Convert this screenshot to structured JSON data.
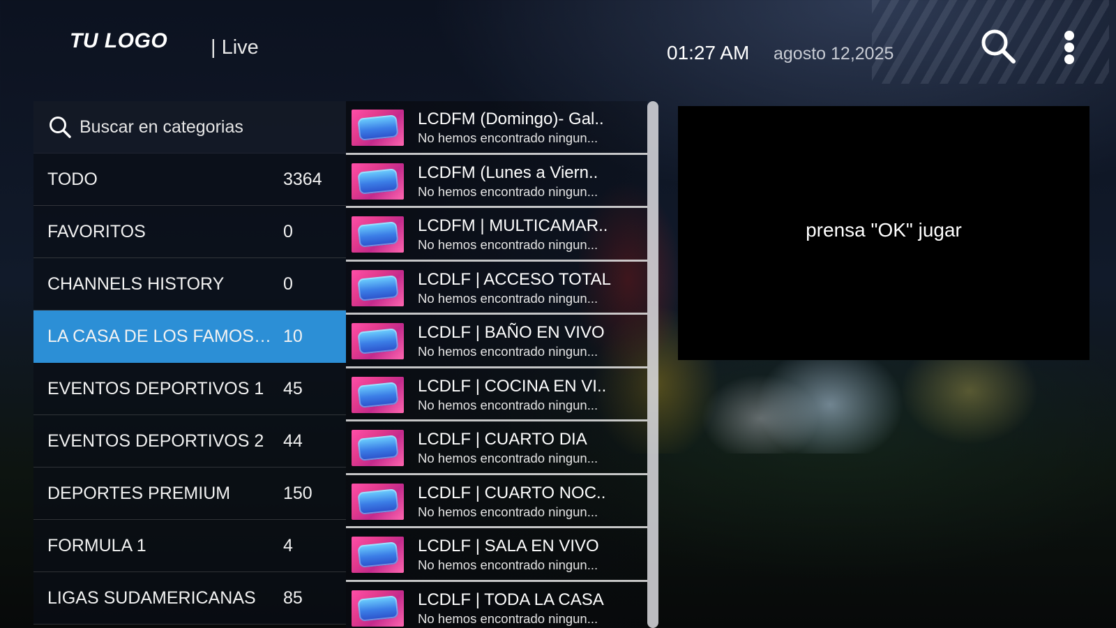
{
  "header": {
    "logo": "TU LOGO",
    "section": "| Live",
    "time": "01:27 AM",
    "date": "agosto 12,2025",
    "search_icon": "search-icon",
    "menu_icon": "more-vertical-icon"
  },
  "categories": {
    "search_placeholder": "Buscar en categorias",
    "active_index": 3,
    "accent_color": "#2c8fd6",
    "items": [
      {
        "name": "TODO",
        "count": "3364"
      },
      {
        "name": "FAVORITOS",
        "count": "0"
      },
      {
        "name": "CHANNELS HISTORY",
        "count": "0"
      },
      {
        "name": "LA CASA DE LOS FAMOSOS MEXICO",
        "count": "10"
      },
      {
        "name": "EVENTOS DEPORTIVOS 1",
        "count": "45"
      },
      {
        "name": "EVENTOS DEPORTIVOS 2",
        "count": "44"
      },
      {
        "name": "DEPORTES PREMIUM",
        "count": "150"
      },
      {
        "name": "FORMULA 1",
        "count": "4"
      },
      {
        "name": "LIGAS SUDAMERICANAS",
        "count": "85"
      }
    ]
  },
  "channels": {
    "items": [
      {
        "title": "LCDFM (Domingo)- Gal..",
        "subtitle": "No hemos encontrado ningun..."
      },
      {
        "title": "LCDFM (Lunes a Viern..",
        "subtitle": "No hemos encontrado ningun..."
      },
      {
        "title": "LCDFM | MULTICAMAR..",
        "subtitle": "No hemos encontrado ningun..."
      },
      {
        "title": "LCDLF | ACCESO TOTAL",
        "subtitle": "No hemos encontrado ningun..."
      },
      {
        "title": "LCDLF | BAÑO EN VIVO",
        "subtitle": "No hemos encontrado ningun..."
      },
      {
        "title": "LCDLF | COCINA EN VI..",
        "subtitle": "No hemos encontrado ningun..."
      },
      {
        "title": "LCDLF | CUARTO DIA",
        "subtitle": "No hemos encontrado ningun..."
      },
      {
        "title": "LCDLF | CUARTO NOC..",
        "subtitle": "No hemos encontrado ningun..."
      },
      {
        "title": "LCDLF | SALA EN VIVO",
        "subtitle": "No hemos encontrado ningun..."
      },
      {
        "title": "LCDLF | TODA LA CASA",
        "subtitle": "No hemos encontrado ningun..."
      }
    ]
  },
  "preview": {
    "message": "prensa \"OK\" jugar"
  }
}
